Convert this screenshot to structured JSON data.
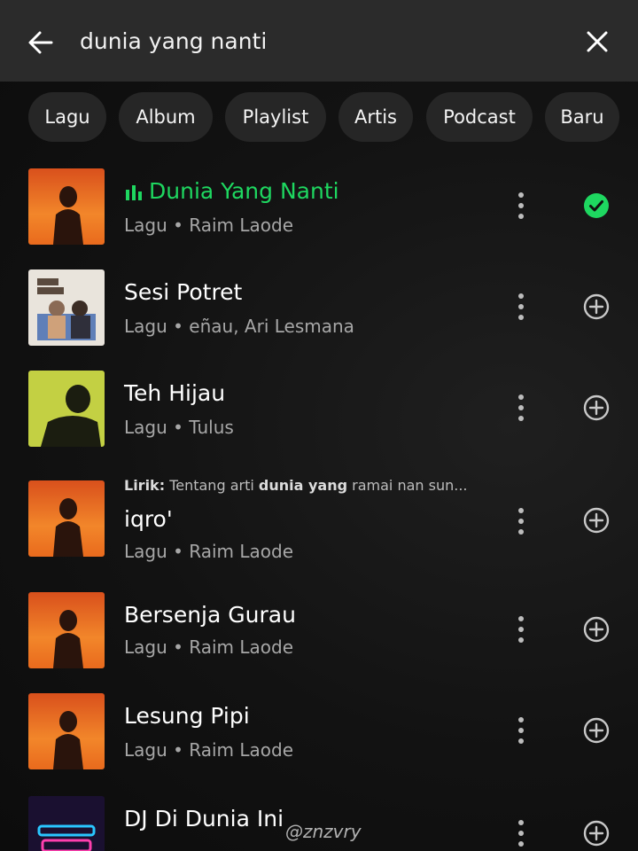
{
  "search": {
    "query": "dunia yang nanti",
    "back_icon": "arrow-left-icon",
    "clear_icon": "close-icon"
  },
  "filters": [
    "Lagu",
    "Album",
    "Playlist",
    "Artis",
    "Podcast",
    "Baru"
  ],
  "colors": {
    "accent": "#1ed760",
    "header_bg": "#2b2b2b",
    "chip_bg": "#262626",
    "text_secondary": "#a7a7a7"
  },
  "results": [
    {
      "title": "Dunia Yang Nanti",
      "subtitle": "Lagu • Raim Laode",
      "playing": true,
      "saved": true,
      "cover": "orange-silhouette"
    },
    {
      "title": "Sesi Potret",
      "subtitle": "Lagu • eñau, Ari Lesmana",
      "playing": false,
      "saved": false,
      "cover": "sesi-potret-art"
    },
    {
      "title": "Teh Hijau",
      "subtitle": "Lagu • Tulus",
      "playing": false,
      "saved": false,
      "cover": "green-silhouette"
    },
    {
      "title": "iqro'",
      "subtitle": "Lagu • Raim Laode",
      "playing": false,
      "saved": false,
      "cover": "orange-silhouette",
      "lyric_label": "Lirik:",
      "lyric_pre": "Tentang arti",
      "lyric_match": "dunia yang",
      "lyric_post": "ramai nan sun..."
    },
    {
      "title": "Bersenja Gurau",
      "subtitle": "Lagu • Raim Laode",
      "playing": false,
      "saved": false,
      "cover": "orange-silhouette"
    },
    {
      "title": "Lesung Pipi",
      "subtitle": "Lagu • Raim Laode",
      "playing": false,
      "saved": false,
      "cover": "orange-silhouette"
    },
    {
      "title": "DJ Di Dunia Ini",
      "subtitle": "",
      "playing": false,
      "saved": false,
      "cover": "neon-dj-art"
    }
  ],
  "watermark": "@znzvry"
}
